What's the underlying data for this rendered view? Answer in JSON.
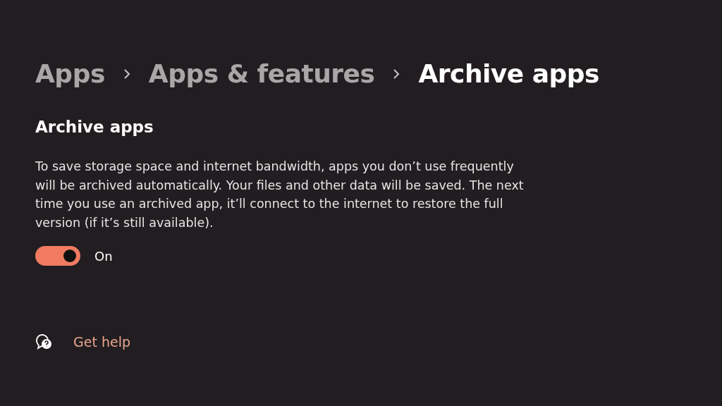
{
  "breadcrumb": [
    {
      "label": "Apps",
      "selected": false
    },
    {
      "label": "Apps & features",
      "selected": false
    },
    {
      "label": "Archive apps",
      "selected": true
    }
  ],
  "section": {
    "title": "Archive apps",
    "description": "To save storage space and internet bandwidth, apps you don’t use frequently will be archived automatically. Your files and other data will be saved. The next time you use an archived app, it’ll connect to the internet to restore the full version (if it’s still available)."
  },
  "toggle": {
    "on": true,
    "label": "On"
  },
  "help_link": {
    "label": "Get help"
  }
}
